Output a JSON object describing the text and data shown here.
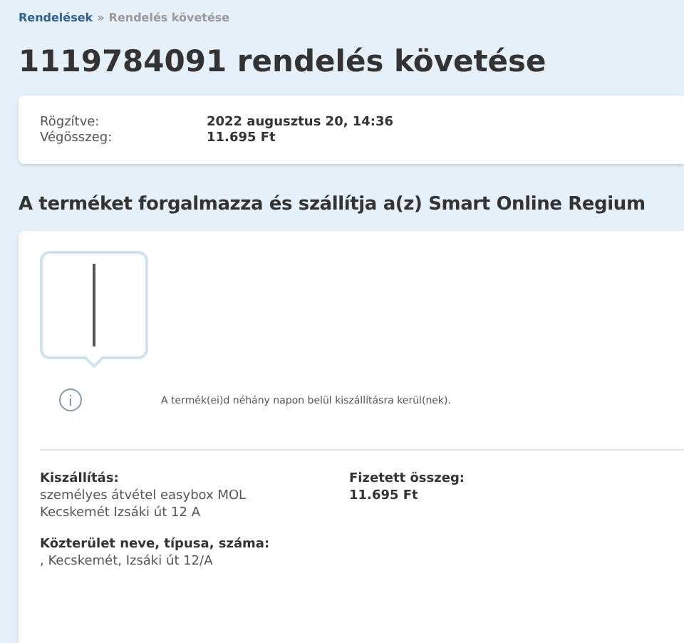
{
  "breadcrumb": [
    {
      "label": "Rendelések",
      "link": true
    },
    {
      "label": "»",
      "link": false
    },
    {
      "label": "Rendelés követése",
      "link": false
    }
  ],
  "title": "1119784091 rendelés követése",
  "summary": [
    {
      "label": "Rögzítve:",
      "value": "2022 augusztus 20, 14:36"
    },
    {
      "label": "Végösszeg:",
      "value": "11.695 Ft"
    }
  ],
  "seller_heading": "A terméket forgalmazza és szállítja a(z) Smart Online Regium",
  "shipment": {
    "status_message": "A termék(ei)d néhány napon belül kiszállításra kerül(nek).",
    "details": [
      {
        "label": "Kiszállítás:",
        "lines": [
          "személyes átvétel easybox MOL",
          "Kecskemét Izsáki út 12 A"
        ]
      },
      {
        "label": "Fizetett összeg:",
        "lines": [
          "11.695 Ft"
        ],
        "bold": true
      },
      {
        "label": "Közterület neve, típusa, száma:",
        "lines": [
          ", Kecskemét, Izsáki út 12/A"
        ]
      }
    ]
  }
}
